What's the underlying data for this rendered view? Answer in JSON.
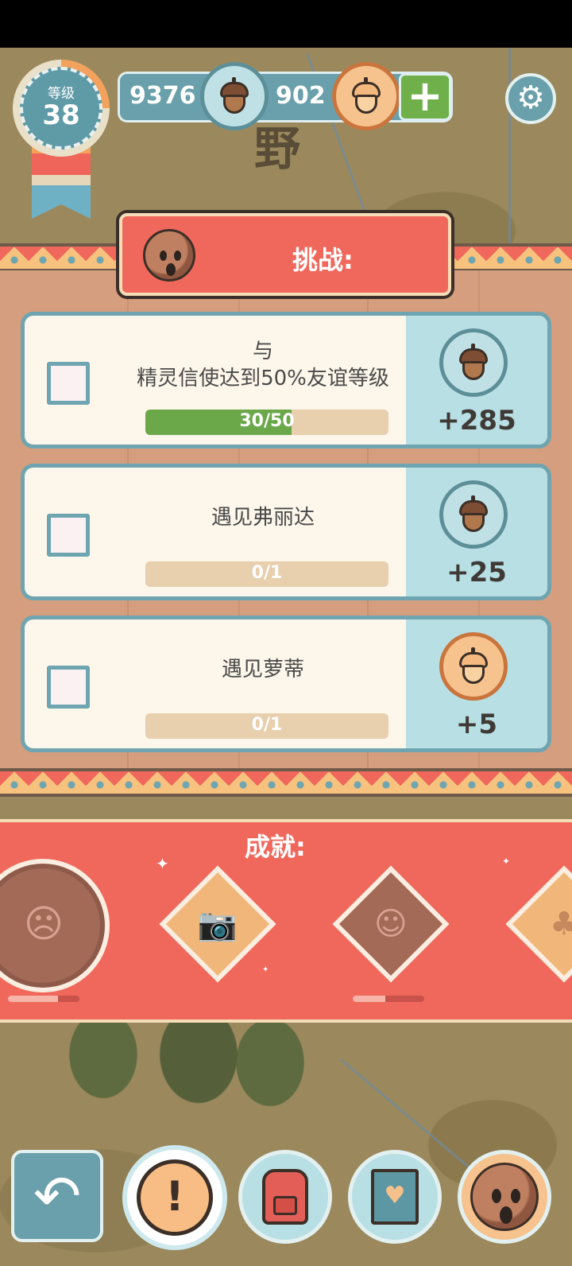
{
  "level": {
    "label": "等级",
    "value": "38"
  },
  "currency": {
    "acorns": "9376",
    "golden_acorns": "902",
    "add_icon": "plus-icon",
    "acorn_icon": "acorn-icon",
    "golden_acorn_icon": "golden-acorn-icon"
  },
  "settings": {
    "icon": "gear-icon"
  },
  "map": {
    "label_kanji": "野"
  },
  "challenges": {
    "title": "挑战:",
    "items": [
      {
        "title_line1": "与",
        "title_line2": "精灵信使达到50%友谊等级",
        "progress_text": "30/50",
        "progress": 0.6,
        "reward": "+285",
        "reward_type": "acorn"
      },
      {
        "title_line1": "遇见弗丽达",
        "title_line2": "",
        "progress_text": "0/1",
        "progress": 0,
        "reward": "+25",
        "reward_type": "acorn"
      },
      {
        "title_line1": "遇见萝蒂",
        "title_line2": "",
        "progress_text": "0/1",
        "progress": 0,
        "reward": "+5",
        "reward_type": "golden-acorn"
      }
    ]
  },
  "achievements": {
    "title": "成就:",
    "items": [
      {
        "icon": "monster-icon",
        "progress": 0.7
      },
      {
        "icon": "camera-icon"
      },
      {
        "icon": "nut-face-icon",
        "progress": 0.45
      },
      {
        "icon": "acorn-icon"
      }
    ]
  },
  "nav": {
    "back_icon": "back-arrow-icon",
    "alert_icon": "exclamation-icon",
    "alert_label": "!",
    "bag_icon": "backpack-icon",
    "book_icon": "heart-book-icon",
    "profile_icon": "nut-avatar-icon"
  },
  "colors": {
    "accent_red": "#f0685c",
    "teal": "#6aa0ab",
    "progress_green": "#6aa84a",
    "reward_bg": "#b7dfe4"
  }
}
